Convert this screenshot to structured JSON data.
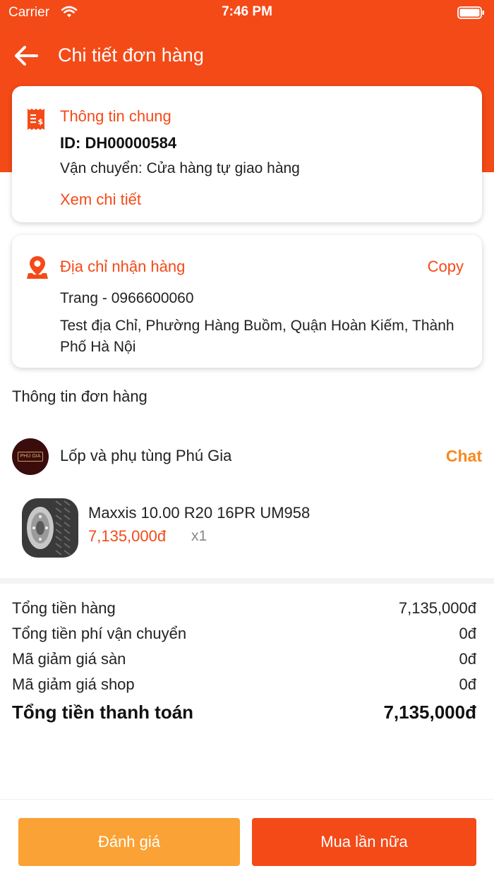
{
  "status_bar": {
    "carrier": "Carrier",
    "time": "7:46 PM"
  },
  "nav": {
    "title": "Chi tiết đơn hàng",
    "back_icon": "arrow-left-icon"
  },
  "general_info": {
    "icon": "receipt-icon",
    "title": "Thông tin chung",
    "order_id": "ID: DH00000584",
    "shipping": "Vận chuyển: Cửa hàng tự giao hàng",
    "see_detail": "Xem chi tiết"
  },
  "address_info": {
    "icon": "location-pin-icon",
    "title": "Địa chỉ nhận hàng",
    "copy_label": "Copy",
    "recipient": "Trang - 0966600060",
    "address": "Test địa Chỉ, Phường Hàng Buồm, Quận Hoàn Kiếm, Thành Phố Hà Nội"
  },
  "order_section": {
    "title": "Thông tin đơn hàng"
  },
  "shop": {
    "avatar_text": "PHÚ GIA",
    "name": "Lốp và phụ tùng Phú Gia",
    "chat_label": "Chat"
  },
  "product": {
    "name": "Maxxis 10.00 R20 16PR UM958",
    "price": "7,135,000đ",
    "quantity": "x1"
  },
  "summary": {
    "rows": [
      {
        "label": "Tổng tiền hàng",
        "value": "7,135,000đ"
      },
      {
        "label": "Tổng tiền phí vận chuyển",
        "value": "0đ"
      },
      {
        "label": "Mã giảm giá sàn",
        "value": "0đ"
      },
      {
        "label": "Mã giảm giá shop",
        "value": "0đ"
      }
    ],
    "total_label": "Tổng tiền thanh toán",
    "total_value": "7,135,000đ"
  },
  "actions": {
    "review_label": "Đánh giá",
    "buy_again_label": "Mua lần nữa"
  },
  "colors": {
    "primary": "#f44a18",
    "secondary": "#faa235",
    "chat": "#f7891f"
  }
}
